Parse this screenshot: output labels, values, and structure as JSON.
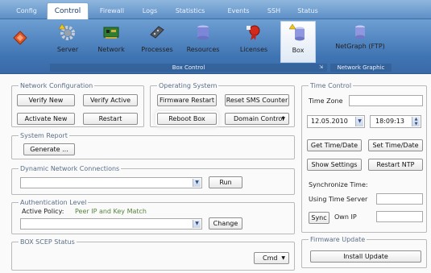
{
  "tabs": [
    {
      "label": "Config",
      "active": false
    },
    {
      "label": "Control",
      "active": true
    },
    {
      "label": "Firewall",
      "active": false
    },
    {
      "label": "Logs",
      "active": false
    },
    {
      "label": "Statistics",
      "active": false
    },
    {
      "label": "Events",
      "active": false
    },
    {
      "label": "SSH",
      "active": false
    },
    {
      "label": "Status",
      "active": false
    }
  ],
  "ribbon": {
    "items": [
      {
        "label": "Server",
        "icon": "gear-icon"
      },
      {
        "label": "Network",
        "icon": "network-card-icon"
      },
      {
        "label": "Processes",
        "icon": "processes-icon"
      },
      {
        "label": "Resources",
        "icon": "resources-icon"
      },
      {
        "label": "Licenses",
        "icon": "licenses-icon"
      },
      {
        "label": "Box",
        "icon": "box-icon",
        "selected": true
      },
      {
        "label": "NetGraph (FTP)",
        "icon": "netgraph-icon"
      }
    ],
    "group_box_control": "Box Control",
    "group_network_graphic": "Network Graphic"
  },
  "network_configuration": {
    "title": "Network Configuration",
    "verify_new": "Verify New",
    "verify_active": "Verify Active",
    "activate_new": "Activate New",
    "restart": "Restart"
  },
  "operating_system": {
    "title": "Operating System",
    "firmware_restart": "Firmware Restart",
    "reset_sms": "Reset SMS Counter",
    "reboot_box": "Reboot Box",
    "domain_control": "Domain Control"
  },
  "system_report": {
    "title": "System Report",
    "generate": "Generate ..."
  },
  "dynamic_network": {
    "title": "Dynamic Network Connections",
    "run": "Run"
  },
  "authentication": {
    "title": "Authentication Level",
    "active_policy_label": "Active Policy:",
    "active_policy_value": "Peer IP and Key Match",
    "change": "Change"
  },
  "box_scep": {
    "title": "BOX SCEP Status",
    "cmd": "Cmd"
  },
  "time_control": {
    "title": "Time Control",
    "time_zone_label": "Time Zone",
    "time_zone_value": "",
    "date": "12.05.2010",
    "time": "18:09:13",
    "get_time": "Get Time/Date",
    "set_time": "Set Time/Date",
    "show_settings": "Show Settings",
    "restart_ntp": "Restart NTP",
    "sync_time_label": "Synchronize Time:",
    "using_time_server": "Using Time Server",
    "sync": "Sync",
    "own_ip": "Own IP"
  },
  "firmware_update": {
    "title": "Firmware Update",
    "install": "Install Update"
  }
}
